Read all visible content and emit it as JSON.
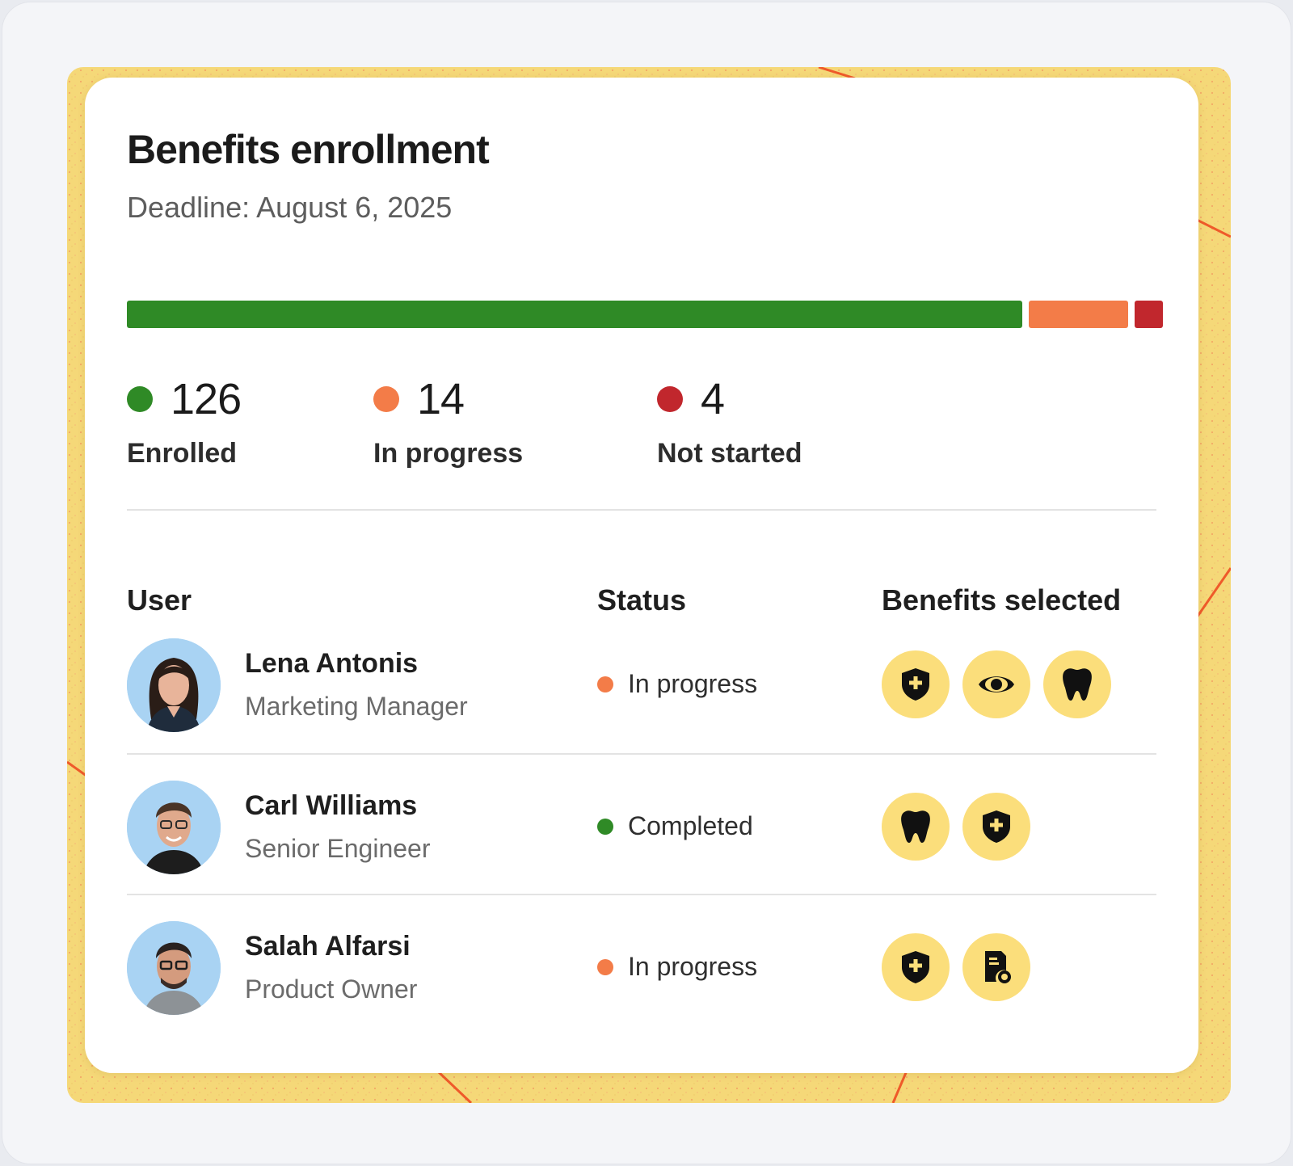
{
  "card": {
    "title": "Benefits enrollment",
    "deadline": "Deadline: August 6, 2025"
  },
  "progress": {
    "segments": [
      {
        "key": "enrolled",
        "value": 126,
        "color": "#2f8a26"
      },
      {
        "key": "in_progress",
        "value": 14,
        "color": "#f37c48"
      },
      {
        "key": "not_started",
        "value": 4,
        "color": "#c1272d"
      }
    ]
  },
  "stats": [
    {
      "count": "126",
      "label": "Enrolled",
      "color": "#2f8a26"
    },
    {
      "count": "14",
      "label": "In progress",
      "color": "#f37c48"
    },
    {
      "count": "4",
      "label": "Not started",
      "color": "#c1272d"
    }
  ],
  "table": {
    "headers": {
      "user": "User",
      "status": "Status",
      "benefits": "Benefits selected"
    },
    "rows": [
      {
        "name": "Lena Antonis",
        "role": "Marketing Manager",
        "status": "In progress",
        "status_color": "#f37c48",
        "benefits": [
          "shield-plus-icon",
          "eye-icon",
          "tooth-icon"
        ]
      },
      {
        "name": "Carl Williams",
        "role": "Senior Engineer",
        "status": "Completed",
        "status_color": "#2f8a26",
        "benefits": [
          "tooth-icon",
          "shield-plus-icon"
        ]
      },
      {
        "name": "Salah Alfarsi",
        "role": "Product Owner",
        "status": "In progress",
        "status_color": "#f37c48",
        "benefits": [
          "shield-plus-icon",
          "document-badge-icon"
        ]
      }
    ]
  }
}
